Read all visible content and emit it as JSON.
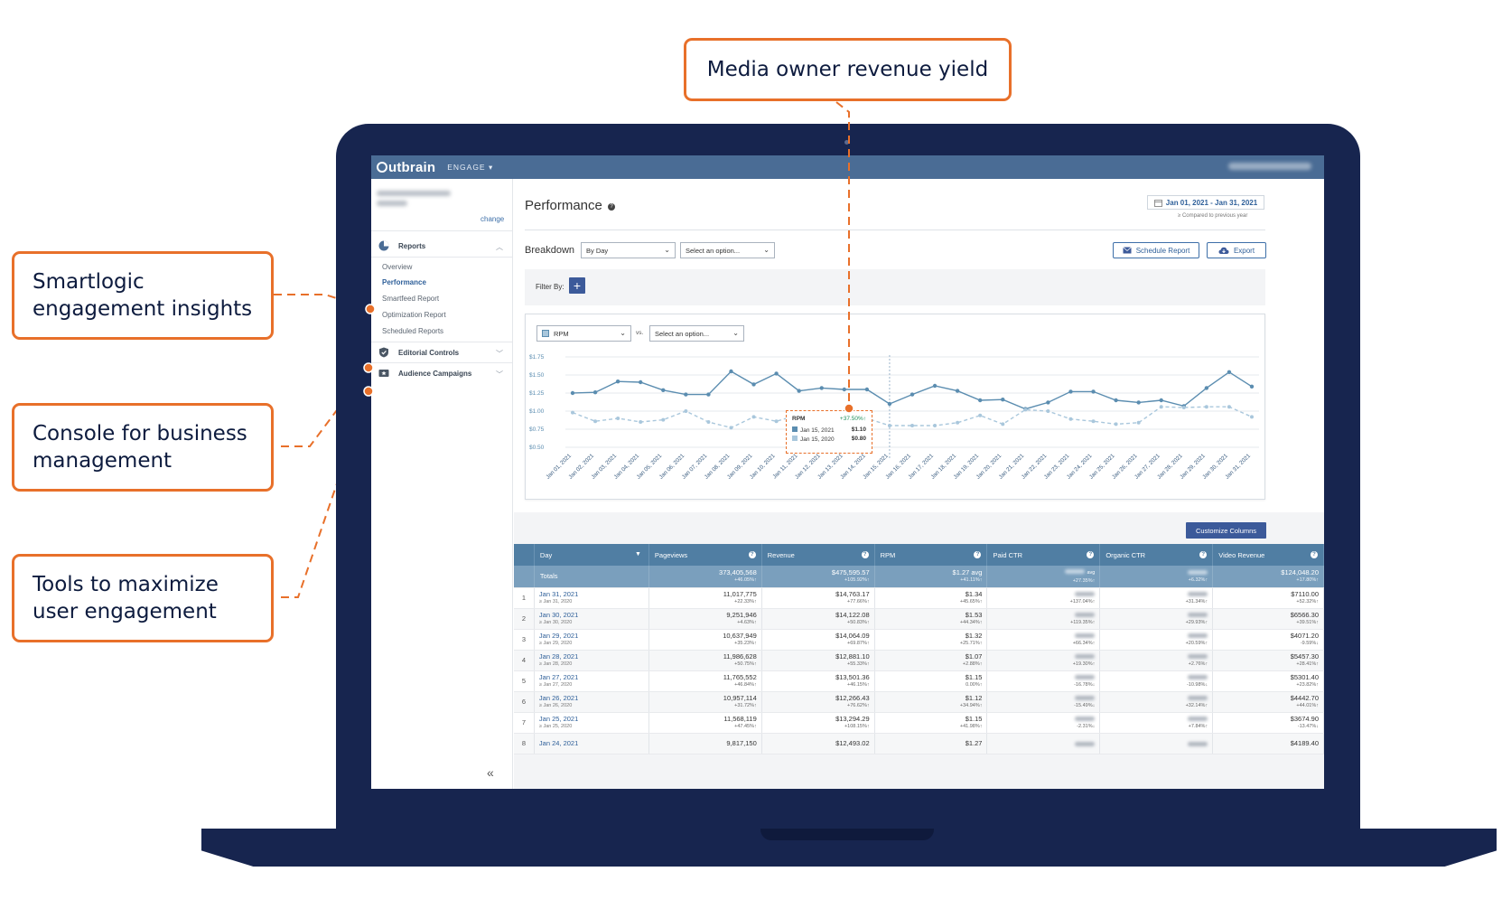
{
  "callouts": {
    "media_owner": "Media owner revenue yield",
    "smartlogic_line1": "Smartlogic",
    "smartlogic_line2": "engagement insights",
    "console_line1": "Console for business",
    "console_line2": "management",
    "tools_line1": "Tools to maximize",
    "tools_line2": "user engagement"
  },
  "colors": {
    "callout_border": "#e8702a",
    "laptop": "#17254f",
    "topbar": "#4a6c95",
    "accent": "#3c5a9a",
    "table_header": "#507ea3",
    "series_2021": "#5b8db0",
    "series_2020": "#a9c7dc",
    "up": "#1f8f5a",
    "down": "#d0342c"
  },
  "topbar": {
    "logo": "utbrain",
    "product": "ENGAGE ▾"
  },
  "sidebar": {
    "change": "change",
    "reports": "Reports",
    "items": [
      "Overview",
      "Performance",
      "Smartfeed Report",
      "Optimization Report",
      "Scheduled Reports"
    ],
    "editorial": "Editorial Controls",
    "audience": "Audience Campaigns",
    "collapse": "«"
  },
  "header": {
    "title": "Performance",
    "date_range": "Jan 01, 2021 - Jan 31, 2021",
    "compare_note": "≥ Compared to previous year"
  },
  "toolbar": {
    "breakdown_label": "Breakdown",
    "breakdown_value": "By Day",
    "option_placeholder": "Select an option...",
    "schedule": "Schedule Report",
    "export": "Export",
    "filter_label": "Filter By:",
    "filter_add": "+"
  },
  "chart_controls": {
    "metric": "RPM",
    "vs": "vs.",
    "compare_placeholder": "Select an option..."
  },
  "tooltip": {
    "title": "RPM",
    "change": "+37.50%↑",
    "row1_label": "Jan 15, 2021",
    "row1_value": "$1.10",
    "row2_label": "Jan 15, 2020",
    "row2_value": "$0.80"
  },
  "chart_data": {
    "type": "line",
    "y_ticks": [
      "$1.75",
      "$1.50",
      "$1.25",
      "$1.00",
      "$0.75",
      "$0.50"
    ],
    "ylim": [
      0.5,
      1.75
    ],
    "categories": [
      "Jan 01, 2021",
      "Jan 02, 2021",
      "Jan 03, 2021",
      "Jan 04, 2021",
      "Jan 05, 2021",
      "Jan 06, 2021",
      "Jan 07, 2021",
      "Jan 08, 2021",
      "Jan 09, 2021",
      "Jan 10, 2021",
      "Jan 11, 2021",
      "Jan 12, 2021",
      "Jan 13, 2021",
      "Jan 14, 2021",
      "Jan 15, 2021",
      "Jan 16, 2021",
      "Jan 17, 2021",
      "Jan 18, 2021",
      "Jan 19, 2021",
      "Jan 20, 2021",
      "Jan 21, 2021",
      "Jan 22, 2021",
      "Jan 23, 2021",
      "Jan 24, 2021",
      "Jan 25, 2021",
      "Jan 26, 2021",
      "Jan 27, 2021",
      "Jan 28, 2021",
      "Jan 29, 2021",
      "Jan 30, 2021",
      "Jan 31, 2021"
    ],
    "series": [
      {
        "values": [
          1.25,
          1.26,
          1.41,
          1.4,
          1.29,
          1.23,
          1.23,
          1.55,
          1.37,
          1.52,
          1.28,
          1.32,
          1.3,
          1.3,
          1.1,
          1.23,
          1.35,
          1.28,
          1.15,
          1.16,
          1.03,
          1.12,
          1.27,
          1.27,
          1.15,
          1.12,
          1.15,
          1.07,
          1.32,
          1.54,
          1.34
        ]
      },
      {
        "values": [
          0.98,
          0.86,
          0.9,
          0.85,
          0.88,
          1.0,
          0.85,
          0.77,
          0.92,
          0.86,
          0.95,
          0.87,
          0.91,
          0.9,
          0.8,
          0.8,
          0.8,
          0.84,
          0.94,
          0.82,
          1.02,
          1.0,
          0.89,
          0.86,
          0.82,
          0.84,
          1.06,
          1.05,
          1.06,
          1.06,
          0.92
        ]
      }
    ]
  },
  "table": {
    "customize": "Customize Columns",
    "columns": [
      "Day",
      "Pageviews",
      "Revenue",
      "RPM",
      "Paid CTR",
      "Organic CTR",
      "Video Revenue"
    ],
    "totals": {
      "label": "Totals",
      "pageviews": "373,405,568",
      "pageviews_change": "+46.05%↑",
      "revenue": "$475,595.57",
      "revenue_change": "+105.92%↑",
      "rpm": "$1.27 avg",
      "rpm_change": "+41.11%↑",
      "paid_suffix": "avg",
      "paid_change": "+27.35%↑",
      "organic_change": "+6.32%↑",
      "video": "$124,048.20",
      "video_change": "+17.80%↑"
    },
    "rows": [
      {
        "n": "1",
        "d1": "Jan 31, 2021",
        "d2": "≥ Jan 31, 2020",
        "pv": "11,017,775",
        "pvc": "+22.33%↑",
        "rev": "$14,763.17",
        "revc": "+77.66%↑",
        "rpm": "$1.34",
        "rpmc": "+45.65%↑",
        "pc": "+137.04%↑",
        "oc": "+31.34%↑",
        "vr": "$7110.00",
        "vrc": "+52.32%↑"
      },
      {
        "n": "2",
        "d1": "Jan 30, 2021",
        "d2": "≥ Jan 30, 2020",
        "pv": "9,251,946",
        "pvc": "+4.63%↑",
        "rev": "$14,122.08",
        "revc": "+50.83%↑",
        "rpm": "$1.53",
        "rpmc": "+44.34%↑",
        "pc": "+119.35%↑",
        "oc": "+29.93%↑",
        "vr": "$6566.30",
        "vrc": "+39.51%↑"
      },
      {
        "n": "3",
        "d1": "Jan 29, 2021",
        "d2": "≥ Jan 29, 2020",
        "pv": "10,637,949",
        "pvc": "+35.23%↑",
        "rev": "$14,064.09",
        "revc": "+69.87%↑",
        "rpm": "$1.32",
        "rpmc": "+25.71%↑",
        "pc": "+66.34%↑",
        "oc": "+20.59%↑",
        "vr": "$4071.20",
        "vrc": "-9.59%↓"
      },
      {
        "n": "4",
        "d1": "Jan 28, 2021",
        "d2": "≥ Jan 28, 2020",
        "pv": "11,986,628",
        "pvc": "+50.75%↑",
        "rev": "$12,881.10",
        "revc": "+55.33%↑",
        "rpm": "$1.07",
        "rpmc": "+2.88%↑",
        "pc": "+19.30%↑",
        "oc": "+2.76%↑",
        "vr": "$5457.30",
        "vrc": "+28.41%↑"
      },
      {
        "n": "5",
        "d1": "Jan 27, 2021",
        "d2": "≥ Jan 27, 2020",
        "pv": "11,765,552",
        "pvc": "+46.84%↑",
        "rev": "$13,501.36",
        "revc": "+46.15%↑",
        "rpm": "$1.15",
        "rpmc": "0.00%↑",
        "pc": "-16.78%↓",
        "oc": "-10.98%↓",
        "vr": "$5301.40",
        "vrc": "+23.82%↑"
      },
      {
        "n": "6",
        "d1": "Jan 26, 2021",
        "d2": "≥ Jan 26, 2020",
        "pv": "10,957,114",
        "pvc": "+31.72%↑",
        "rev": "$12,266.43",
        "revc": "+76.62%↑",
        "rpm": "$1.12",
        "rpmc": "+34.94%↑",
        "pc": "-15.49%↓",
        "oc": "+32.14%↑",
        "vr": "$4442.70",
        "vrc": "+44.01%↑"
      },
      {
        "n": "7",
        "d1": "Jan 25, 2021",
        "d2": "≥ Jan 25, 2020",
        "pv": "11,568,119",
        "pvc": "+47.45%↑",
        "rev": "$13,294.29",
        "revc": "+108.15%↑",
        "rpm": "$1.15",
        "rpmc": "+41.98%↑",
        "pc": "-2.31%↓",
        "oc": "+7.84%↑",
        "vr": "$3674.90",
        "vrc": "-13.47%↓"
      },
      {
        "n": "8",
        "d1": "Jan 24, 2021",
        "d2": "",
        "pv": "9,817,150",
        "pvc": "",
        "rev": "$12,493.02",
        "revc": "",
        "rpm": "$1.27",
        "rpmc": "",
        "pc": "",
        "oc": "",
        "vr": "$4189.40",
        "vrc": ""
      }
    ]
  }
}
